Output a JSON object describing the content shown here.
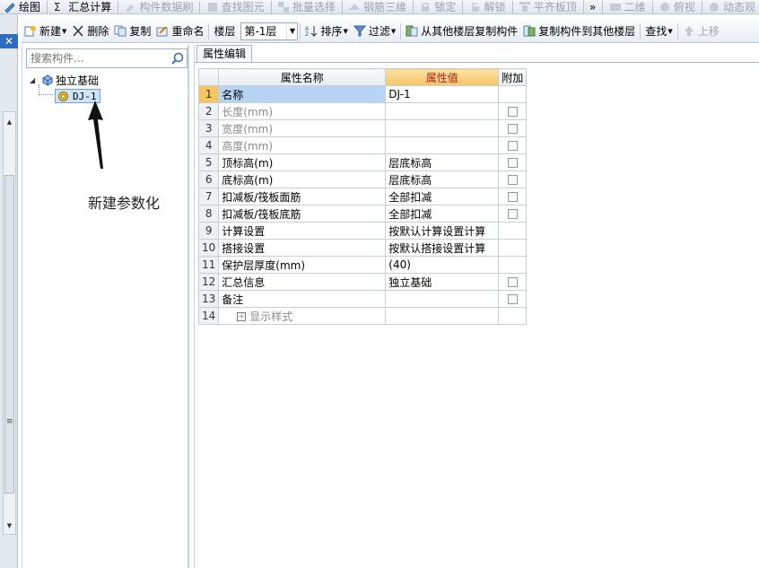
{
  "toolbar_top": {
    "items": [
      {
        "label": "绘图",
        "icon": "draw-icon",
        "dim": false
      },
      {
        "label": "汇总计算",
        "icon": "sigma-icon",
        "dim": false
      },
      {
        "label": "构件数据刷",
        "icon": "brush-icon",
        "dim": true
      },
      {
        "label": "查找图元",
        "icon": "find-icon",
        "dim": true
      },
      {
        "label": "批量选择",
        "icon": "batch-select-icon",
        "dim": true
      },
      {
        "label": "钢筋三维",
        "icon": "rebar-3d-icon",
        "dim": true
      },
      {
        "label": "锁定",
        "icon": "lock-icon",
        "dim": true
      },
      {
        "label": "解锁",
        "icon": "unlock-icon",
        "dim": true
      },
      {
        "label": "平齐板顶",
        "icon": "align-top-icon",
        "dim": true
      },
      {
        "label": "»",
        "icon": "",
        "dim": false
      },
      {
        "label": "二维",
        "icon": "view-2d-icon",
        "dim": true
      },
      {
        "label": "俯视",
        "icon": "top-view-icon",
        "dim": true
      },
      {
        "label": "动态观",
        "icon": "dynamic-view-icon",
        "dim": true
      }
    ]
  },
  "toolbar": {
    "new_label": "新建",
    "delete_label": "删除",
    "copy_label": "复制",
    "rename_label": "重命名",
    "floor_label": "楼层",
    "floor_value": "第-1层",
    "sort_label": "排序",
    "filter_label": "过滤",
    "copy_from_floor_label": "从其他楼层复制构件",
    "copy_to_floor_label": "复制构件到其他楼层",
    "find_label": "查找",
    "up_label": "上移"
  },
  "tree": {
    "search_placeholder": "搜索构件...",
    "root_label": "独立基础",
    "child_label": "DJ-1"
  },
  "annotation": {
    "text": "新建参数化"
  },
  "props": {
    "tab_label": "属性编辑",
    "col_name": "属性名称",
    "col_value": "属性值",
    "col_add": "附加",
    "rows": [
      {
        "num": "1",
        "name": "名称",
        "value": "DJ-1",
        "checkbox": false,
        "gray": false,
        "current": true
      },
      {
        "num": "2",
        "name": "长度(mm)",
        "value": "",
        "checkbox": true,
        "gray": true,
        "current": false
      },
      {
        "num": "3",
        "name": "宽度(mm)",
        "value": "",
        "checkbox": true,
        "gray": true,
        "current": false
      },
      {
        "num": "4",
        "name": "高度(mm)",
        "value": "",
        "checkbox": true,
        "gray": true,
        "current": false
      },
      {
        "num": "5",
        "name": "顶标高(m)",
        "value": "层底标高",
        "checkbox": true,
        "gray": false,
        "current": false
      },
      {
        "num": "6",
        "name": "底标高(m)",
        "value": "层底标高",
        "checkbox": true,
        "gray": false,
        "current": false
      },
      {
        "num": "7",
        "name": "扣减板/筏板面筋",
        "value": "全部扣减",
        "checkbox": true,
        "gray": false,
        "current": false
      },
      {
        "num": "8",
        "name": "扣减板/筏板底筋",
        "value": "全部扣减",
        "checkbox": true,
        "gray": false,
        "current": false
      },
      {
        "num": "9",
        "name": "计算设置",
        "value": "按默认计算设置计算",
        "checkbox": false,
        "gray": false,
        "current": false
      },
      {
        "num": "10",
        "name": "搭接设置",
        "value": "按默认搭接设置计算",
        "checkbox": false,
        "gray": false,
        "current": false
      },
      {
        "num": "11",
        "name": "保护层厚度(mm)",
        "value": "(40)",
        "checkbox": false,
        "gray": false,
        "current": false
      },
      {
        "num": "12",
        "name": "汇总信息",
        "value": "独立基础",
        "checkbox": true,
        "gray": false,
        "current": false
      },
      {
        "num": "13",
        "name": "备注",
        "value": "",
        "checkbox": true,
        "gray": false,
        "current": false
      },
      {
        "num": "14",
        "name": "显示样式",
        "value": "",
        "checkbox": false,
        "gray": true,
        "current": false,
        "group": true
      }
    ]
  },
  "colors": {
    "accent": "#2d6cc0",
    "value_header_bg": "#f6c468",
    "value_header_text": "#b02020",
    "selection": "#cfe3fb"
  }
}
